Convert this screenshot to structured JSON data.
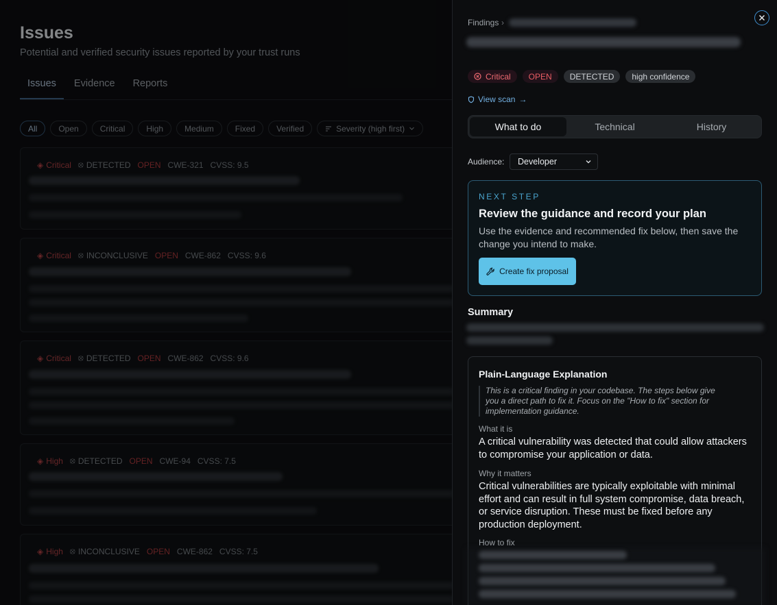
{
  "page": {
    "title": "Issues",
    "subtitle": "Potential and verified security issues reported by your trust runs",
    "tabs": [
      "Issues",
      "Evidence",
      "Reports"
    ],
    "filters": [
      "All",
      "Open",
      "Critical",
      "High",
      "Medium",
      "Fixed",
      "Verified"
    ],
    "sort_label": "Severity (high first)"
  },
  "issues": [
    {
      "severity": "Critical",
      "status": "DETECTED",
      "state": "OPEN",
      "cwe": "CWE-321",
      "cvss": "CVSS: 9.5"
    },
    {
      "severity": "Critical",
      "status": "INCONCLUSIVE",
      "state": "OPEN",
      "cwe": "CWE-862",
      "cvss": "CVSS: 9.6"
    },
    {
      "severity": "Critical",
      "status": "DETECTED",
      "state": "OPEN",
      "cwe": "CWE-862",
      "cvss": "CVSS: 9.6"
    },
    {
      "severity": "High",
      "status": "DETECTED",
      "state": "OPEN",
      "cwe": "CWE-94",
      "cvss": "CVSS: 7.5"
    },
    {
      "severity": "High",
      "status": "INCONCLUSIVE",
      "state": "OPEN",
      "cwe": "CWE-862",
      "cvss": "CVSS: 7.5"
    }
  ],
  "drawer": {
    "breadcrumb": "Findings",
    "badges": {
      "severity": "Critical",
      "state": "OPEN",
      "status": "DETECTED",
      "confidence": "high confidence"
    },
    "view_scan": "View scan",
    "seg_tabs": [
      "What to do",
      "Technical",
      "History"
    ],
    "audience_label": "Audience:",
    "audience_value": "Developer",
    "next_step": {
      "eyebrow": "NEXT STEP",
      "title": "Review the guidance and record your plan",
      "body": "Use the evidence and recommended fix below, then save the change you intend to make.",
      "button": "Create fix proposal"
    },
    "summary_heading": "Summary",
    "explanation": {
      "title": "Plain-Language Explanation",
      "quote": "This is a critical finding in your codebase. The steps below give you a direct path to fix it. Focus on the \"How to fix\" section for implementation guidance.",
      "what_label": "What it is",
      "what_text": "A critical vulnerability was detected that could allow attackers to compromise your application or data.",
      "why_label": "Why it matters",
      "why_text": "Critical vulnerabilities are typically exploitable with minimal effort and can result in full system compromise, data breach, or service disruption. These must be fixed before any production deployment.",
      "how_label": "How to fix"
    }
  },
  "colors": {
    "accent": "#5ec2e8",
    "critical": "#f06b72",
    "link": "#73b1e3"
  }
}
